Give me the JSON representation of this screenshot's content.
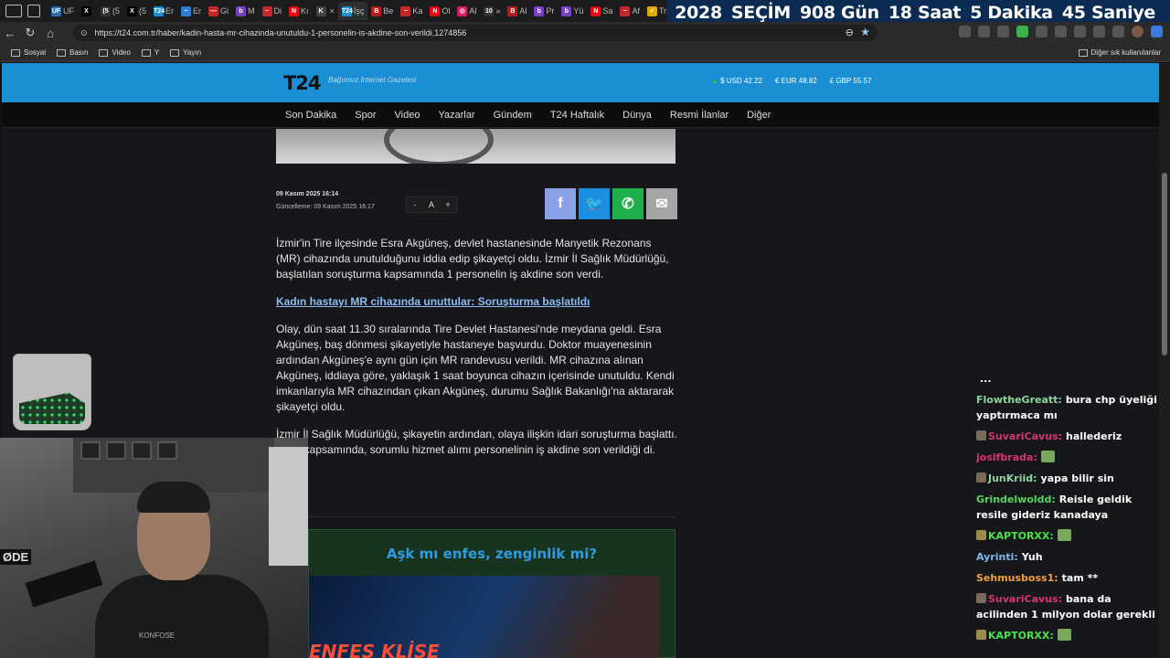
{
  "browser": {
    "tabs": [
      {
        "icon": "UF",
        "label": "UF",
        "color": "#2f6bb3"
      },
      {
        "icon": "X",
        "label": "",
        "color": "#000000"
      },
      {
        "icon": "(5",
        "label": "(5",
        "color": "#333333"
      },
      {
        "icon": "X",
        "label": "(5",
        "color": "#000000"
      },
      {
        "icon": "T24",
        "label": "Er",
        "color": "#1a8fd3"
      },
      {
        "icon": "~",
        "label": "Er",
        "color": "#2a7fd0"
      },
      {
        "icon": "—",
        "label": "Gi",
        "color": "#c62828"
      },
      {
        "icon": "b",
        "label": "M",
        "color": "#7a3fc8"
      },
      {
        "icon": "~",
        "label": "Di",
        "color": "#c62828"
      },
      {
        "icon": "N",
        "label": "Kı",
        "color": "#e50914"
      },
      {
        "icon": "K",
        "label": "",
        "color": "#444444"
      }
    ],
    "tabs2": [
      {
        "icon": "T24",
        "label": "İşç",
        "color": "#1a8fd3"
      },
      {
        "icon": "B",
        "label": "Be",
        "color": "#b71c1c"
      },
      {
        "icon": "~",
        "label": "Ka",
        "color": "#c62828"
      },
      {
        "icon": "N",
        "label": "Ol",
        "color": "#e50914"
      },
      {
        "icon": "◎",
        "label": "Al",
        "color": "#d81b60"
      },
      {
        "icon": "10",
        "label": "»",
        "color": "#333333"
      },
      {
        "icon": "B",
        "label": "Al",
        "color": "#b71c1c"
      },
      {
        "icon": "b",
        "label": "Pr",
        "color": "#7a3fc8"
      },
      {
        "icon": "b",
        "label": "Yü",
        "color": "#7a3fc8"
      },
      {
        "icon": "N",
        "label": "Sa",
        "color": "#e50914"
      },
      {
        "icon": "~",
        "label": "Af",
        "color": "#c62828"
      },
      {
        "icon": "✓",
        "label": "Trı",
        "color": "#e0a800"
      }
    ],
    "countdown": {
      "year": "2028",
      "event": "SEÇİM",
      "days": "908 Gün",
      "hours": "18 Saat",
      "minutes": "5 Dakika",
      "seconds": "45 Saniye"
    },
    "url": "https://t24.com.tr/haber/kadin-hasta-mr-cihazinda-unutuldu-1-personelin-is-akdine-son-verildi,1274856",
    "bookmarks": [
      "Sosyal",
      "Basın",
      "Video",
      "Y",
      "Yayın"
    ],
    "other_bookmarks": "Diğer sık kullanılanlar"
  },
  "site": {
    "logo": "T24",
    "slogan": "Bağımsız İnternet Gazetesi",
    "currencies": [
      {
        "label": "$ USD 42.22"
      },
      {
        "label": "€ EUR 48.82"
      },
      {
        "label": "£ GBP 55.57"
      }
    ],
    "nav": [
      "Son Dakika",
      "Spor",
      "Video",
      "Yazarlar",
      "Gündem",
      "T24 Haftalık",
      "Dünya",
      "Resmi İlanlar",
      "Diğer"
    ]
  },
  "article": {
    "published": "09 Kasım 2025 16:14",
    "updated": "Güncelleme: 09 Kasım 2025 16:17",
    "font_controls": [
      "-",
      "A",
      "+"
    ],
    "paragraphs": [
      "İzmir'in Tire ilçesinde Esra Akgüneş, devlet hastanesinde Manyetik Rezonans (MR) cihazında unutulduğunu iddia edip şikayetçi oldu. İzmir İl Sağlık Müdürlüğü, başlatılan soruşturma kapsamında 1 personelin iş akdine son verdi.",
      "Olay, dün saat 11.30 sıralarında Tire Devlet Hastanesi'nde meydana geldi. Esra Akgüneş, baş dönmesi şikayetiyle hastaneye başvurdu. Doktor muayenesinin ardından Akgüneş'e aynı gün için MR randevusu verildi. MR cihazına alınan Akgüneş, iddiaya göre, yaklaşık 1 saat boyunca cihazın içerisinde unutuldu. Kendi imkanlarıyla MR cihazından çıkan Akgüneş, durumu Sağlık Bakanlığı'na aktararak şikayetçi oldu.",
      "İzmir İl Sağlık Müdürlüğü, şikayetin ardından, olaya ilişkin idari soruşturma başlattı. urma kapsamında, sorumlu hizmet alımı personelinin iş akdine son verildiği di. (DHA)"
    ],
    "related_link": "Kadın hastayı MR cihazında unuttular: Soruşturma başlatıldı"
  },
  "ad": {
    "headline": "Aşk mı enfes, zenginlik mi?",
    "image_text": "ENFES KLİŞE"
  },
  "stream": {
    "webcam_brand": "ØDE",
    "chair_logo": "KONFOSE"
  },
  "chat": [
    {
      "user": "",
      "text": "...",
      "color": "#dddddd",
      "badge": "",
      "emote": false
    },
    {
      "user": "FlowtheGreatt:",
      "text": "bura chp üyeliği yaptırmaca mı",
      "color": "#8fd4a0",
      "badge": "",
      "emote": false
    },
    {
      "user": "SuvariCavus:",
      "text": "hallederiz",
      "color": "#d7346f",
      "badge": "#7a6a5a",
      "emote": false
    },
    {
      "user": "josifbrada:",
      "text": "",
      "color": "#d7346f",
      "badge": "",
      "emote": true
    },
    {
      "user": "JunKriid:",
      "text": "yapa bilir sin",
      "color": "#8fd4a0",
      "badge": "#7a6a5a",
      "emote": false
    },
    {
      "user": "Grindelwoldd:",
      "text": "Reisle geldik resile gideriz kanadaya",
      "color": "#58d65e",
      "badge": "",
      "emote": false
    },
    {
      "user": "KAPTORXX:",
      "text": "",
      "color": "#4ce04c",
      "badge": "#9c8a4a",
      "emote": true
    },
    {
      "user": "Ayrinti:",
      "text": "Yuh",
      "color": "#7ab8f0",
      "badge": "",
      "emote": false
    },
    {
      "user": "Sehmusboss1:",
      "text": "tam **",
      "color": "#f0a040",
      "badge": "",
      "emote": false
    },
    {
      "user": "SuvariCavus:",
      "text": "bana da acilinden 1 milyon dolar gerekli",
      "color": "#d7346f",
      "badge": "#7a6a5a",
      "emote": false
    },
    {
      "user": "KAPTORXX:",
      "text": "",
      "color": "#4ce04c",
      "badge": "#9c8a4a",
      "emote": true
    }
  ]
}
